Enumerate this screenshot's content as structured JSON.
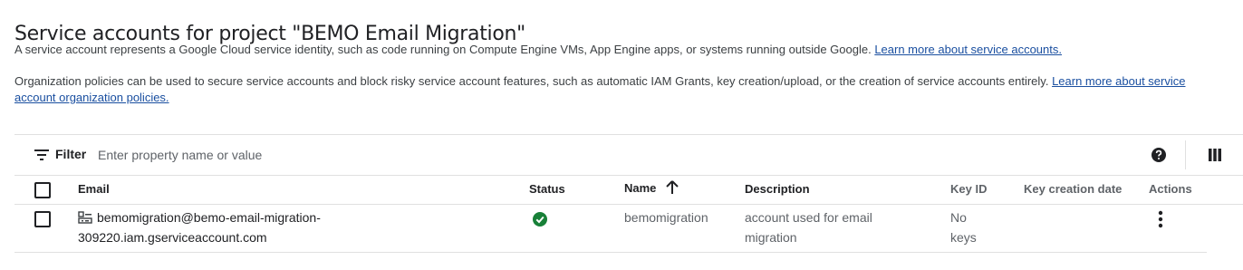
{
  "page": {
    "title": "Service accounts for project \"BEMO Email Migration\"",
    "intro_text": "A service account represents a Google Cloud service identity, such as code running on Compute Engine VMs, App Engine apps, or systems running outside Google. ",
    "intro_link": "Learn more about service accounts.",
    "policy_text": "Organization policies can be used to secure service accounts and block risky service account features, such as automatic IAM Grants, key creation/upload, or the creation of service accounts entirely. ",
    "policy_link": "Learn more about service account organization policies."
  },
  "toolbar": {
    "filter_label": "Filter",
    "filter_placeholder": "Enter property name or value",
    "icons": [
      "filter-icon",
      "help-icon",
      "column-display-icon"
    ]
  },
  "table": {
    "columns": [
      "Email",
      "Status",
      "Name",
      "Description",
      "Key ID",
      "Key creation date",
      "Actions"
    ],
    "sort_column": "Name",
    "sort_direction": "ascending",
    "rows": [
      {
        "email_line1": "bemomigration@bemo-email-migration-",
        "email_line2": "309220.iam.gserviceaccount.com",
        "status": "enabled",
        "name": "bemomigration",
        "description_line1": "account used for email",
        "description_line2": "migration",
        "key_id_line1": "No",
        "key_id_line2": "keys",
        "key_creation_date": ""
      }
    ]
  },
  "colors": {
    "link": "#1a4fa0",
    "status_ok": "#188038",
    "divider": "#e0e0e0"
  }
}
